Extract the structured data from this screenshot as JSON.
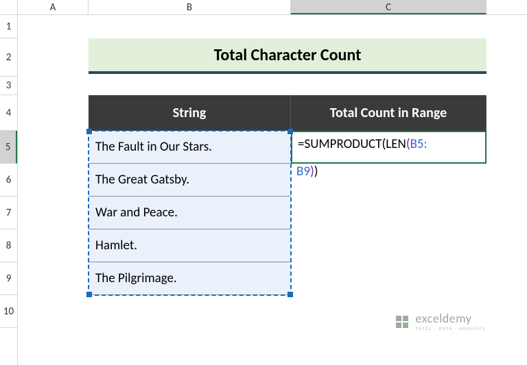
{
  "columns": {
    "a": "A",
    "b": "B",
    "c": "C"
  },
  "rows": {
    "r1": "1",
    "r2": "2",
    "r3": "3",
    "r4": "4",
    "r5": "5",
    "r6": "6",
    "r7": "7",
    "r8": "8",
    "r9": "9",
    "r10": "10"
  },
  "title": "Total Character Count",
  "headers": {
    "string": "String",
    "count": "Total Count in Range"
  },
  "data": {
    "strings": [
      "The Fault in Our Stars.",
      "The Great Gatsby.",
      "War and Peace.",
      "Hamlet.",
      "The Pilgrimage."
    ]
  },
  "formula": {
    "prefix": "=SUMPRODUCT",
    "open1": "(",
    "fn2": "LEN",
    "open2": "(",
    "ref1": "B5:",
    "ref2": "B9",
    "close2": ")",
    "close1": ")"
  },
  "watermark": {
    "brand": "exceldemy",
    "sub": "EXCEL · DATA · ANALYSIS"
  }
}
